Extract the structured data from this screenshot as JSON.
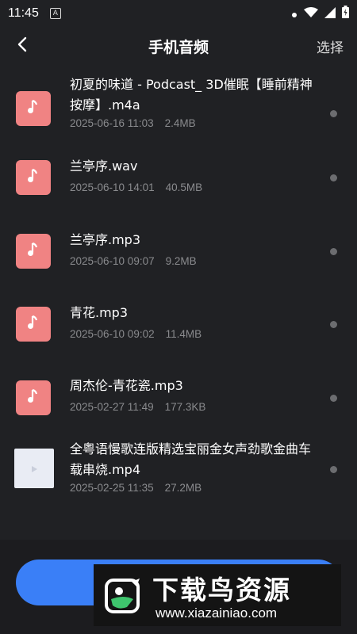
{
  "status_bar": {
    "time": "11:45",
    "notif_letter": "A"
  },
  "header": {
    "back_icon": "chevron-left-icon",
    "title": "手机音频",
    "select_label": "选择"
  },
  "files": [
    {
      "name": "初夏的味道 - Podcast_ 3D催眠【睡前精神按摩】.m4a",
      "date": "2025-06-16 11:03",
      "size": "2.4MB",
      "icon": "music-note-icon"
    },
    {
      "name": "兰亭序.wav",
      "date": "2025-06-10 14:01",
      "size": "40.5MB",
      "icon": "music-note-icon"
    },
    {
      "name": "兰亭序.mp3",
      "date": "2025-06-10 09:07",
      "size": "9.2MB",
      "icon": "music-note-icon"
    },
    {
      "name": "青花.mp3",
      "date": "2025-06-10 09:02",
      "size": "11.4MB",
      "icon": "music-note-icon"
    },
    {
      "name": "周杰伦-青花瓷.mp3",
      "date": "2025-02-27 11:49",
      "size": "177.3KB",
      "icon": "music-note-icon"
    },
    {
      "name": "全粤语慢歌连版精选宝丽金女声劲歌金曲车载串烧.mp4",
      "date": "2025-02-25 11:35",
      "size": "27.2MB",
      "icon": "play-icon"
    }
  ],
  "watermark": {
    "title": "下载鸟资源",
    "url": "www.xiazainiao.com"
  },
  "colors": {
    "background": "#202124",
    "audio_thumb": "#f08383",
    "accent_button": "#3a7ff7"
  }
}
